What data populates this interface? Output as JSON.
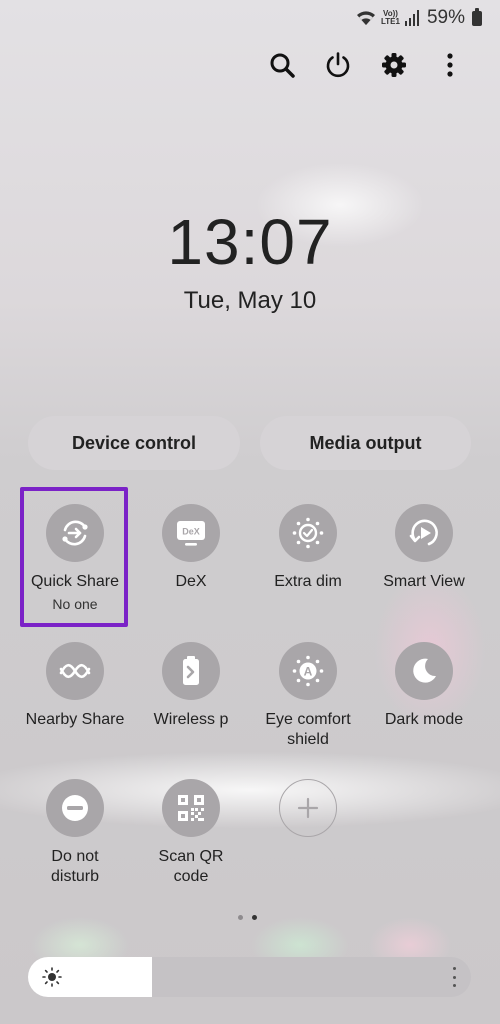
{
  "status": {
    "volte_top": "Vo))",
    "volte_bottom": "LTE1",
    "battery": "59%"
  },
  "top_actions": [
    {
      "name": "search",
      "icon": "search-icon"
    },
    {
      "name": "power",
      "icon": "power-icon"
    },
    {
      "name": "settings",
      "icon": "gear-icon"
    },
    {
      "name": "more",
      "icon": "more-vertical-icon"
    }
  ],
  "clock": {
    "time": "13:07",
    "date": "Tue, May 10"
  },
  "controls": {
    "device_control": "Device control",
    "media_output": "Media output"
  },
  "tiles": {
    "quick_share": {
      "label": "Quick Share",
      "sub": "No one"
    },
    "dex": {
      "label": "DeX",
      "icon_text": "DeX"
    },
    "extra_dim": {
      "label": "Extra dim"
    },
    "smart_view": {
      "label": "Smart View"
    },
    "nearby_share": {
      "label": "Nearby Share"
    },
    "wireless": {
      "label": "Wireless p"
    },
    "eye_comfort": {
      "label_1": "Eye comfort",
      "label_2": "shield",
      "icon_text": "A"
    },
    "dark_mode": {
      "label": "Dark mode"
    },
    "dnd": {
      "label_1": "Do not",
      "label_2": "disturb"
    },
    "scan_qr": {
      "label_1": "Scan QR",
      "label_2": "code"
    },
    "add": {
      "icon": "plus-icon"
    }
  },
  "pager": {
    "pages": 2,
    "active": 2
  },
  "brightness": {
    "level": 0.28
  },
  "colors": {
    "highlight": "#7b22c7",
    "tile": "#a9a6a9",
    "text": "#222222"
  }
}
